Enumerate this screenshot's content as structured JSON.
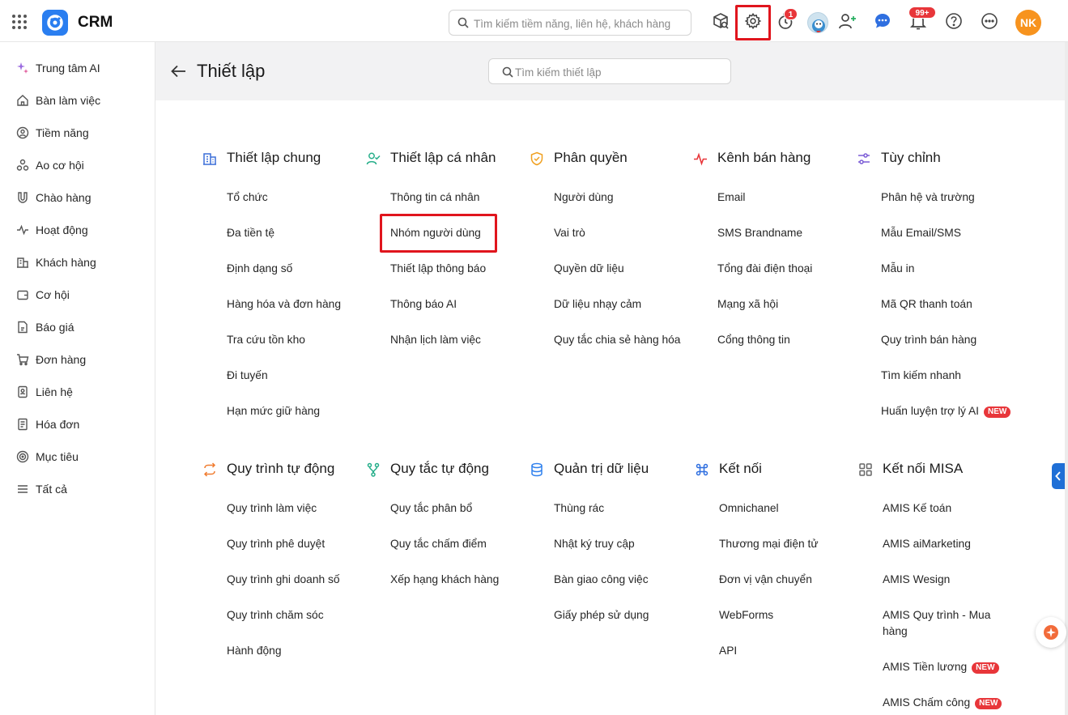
{
  "topbar": {
    "app_title": "CRM",
    "search_placeholder": "Tìm kiếm tiềm năng, liên hệ, khách hàng",
    "timer_badge": "1",
    "notification_badge": "99+",
    "avatar_initials": "NK",
    "icons": [
      "apps-grid-icon",
      "crm-logo-icon",
      "search-icon",
      "package-search-icon",
      "settings-gear-icon",
      "timer-icon",
      "bot-avatar-icon",
      "add-user-icon",
      "chat-icon",
      "bell-icon",
      "help-icon",
      "more-icon"
    ]
  },
  "sidebar": {
    "items": [
      {
        "label": "Trung tâm AI",
        "icon": "sparkle-icon"
      },
      {
        "label": "Bàn làm việc",
        "icon": "home-icon"
      },
      {
        "label": "Tiềm năng",
        "icon": "target-icon"
      },
      {
        "label": "Ao cơ hội",
        "icon": "nodes-icon"
      },
      {
        "label": "Chào hàng",
        "icon": "magnet-icon"
      },
      {
        "label": "Hoạt động",
        "icon": "activity-icon"
      },
      {
        "label": "Khách hàng",
        "icon": "building-icon"
      },
      {
        "label": "Cơ hội",
        "icon": "wallet-icon"
      },
      {
        "label": "Báo giá",
        "icon": "quote-file-icon"
      },
      {
        "label": "Đơn hàng",
        "icon": "cart-icon"
      },
      {
        "label": "Liên hệ",
        "icon": "contact-card-icon"
      },
      {
        "label": "Hóa đơn",
        "icon": "invoice-icon"
      },
      {
        "label": "Mục tiêu",
        "icon": "goal-icon"
      },
      {
        "label": "Tất cả",
        "icon": "menu-icon"
      }
    ]
  },
  "header": {
    "title": "Thiết lập",
    "search_placeholder": "Tìm kiếm thiết lập"
  },
  "groups": [
    {
      "title": "Thiết lập chung",
      "icon": "building-icon",
      "color": "#3b6fd8",
      "items": [
        {
          "label": "Tổ chức"
        },
        {
          "label": "Đa tiền tệ"
        },
        {
          "label": "Định dạng số"
        },
        {
          "label": "Hàng hóa và đơn hàng"
        },
        {
          "label": "Tra cứu tồn kho"
        },
        {
          "label": "Đi tuyến"
        },
        {
          "label": "Hạn mức giữ hàng"
        }
      ]
    },
    {
      "title": "Thiết lập cá nhân",
      "icon": "user-check-icon",
      "color": "#27ae8a",
      "items": [
        {
          "label": "Thông tin cá nhân"
        },
        {
          "label": "Nhóm người dùng"
        },
        {
          "label": "Thiết lập thông báo"
        },
        {
          "label": "Thông báo AI"
        },
        {
          "label": "Nhận lịch làm việc"
        }
      ]
    },
    {
      "title": "Phân quyền",
      "icon": "shield-check-icon",
      "color": "#f0a020",
      "items": [
        {
          "label": "Người dùng"
        },
        {
          "label": "Vai trò"
        },
        {
          "label": "Quyền dữ liệu"
        },
        {
          "label": "Dữ liệu nhạy cảm"
        },
        {
          "label": "Quy tắc chia sẻ hàng hóa"
        }
      ]
    },
    {
      "title": "Kênh bán hàng",
      "icon": "pulse-icon",
      "color": "#e8363a",
      "items": [
        {
          "label": "Email"
        },
        {
          "label": "SMS Brandname"
        },
        {
          "label": "Tổng đài điện thoại"
        },
        {
          "label": "Mạng xã hội"
        },
        {
          "label": "Cổng thông tin"
        }
      ]
    },
    {
      "title": "Tùy chỉnh",
      "icon": "sliders-icon",
      "color": "#7b5cd6",
      "items": [
        {
          "label": "Phân hệ và trường"
        },
        {
          "label": "Mẫu Email/SMS"
        },
        {
          "label": "Mẫu in"
        },
        {
          "label": "Mã QR thanh toán"
        },
        {
          "label": "Quy trình bán hàng"
        },
        {
          "label": "Tìm kiếm nhanh"
        },
        {
          "label": "Huấn luyện trợ lý AI",
          "badge": "NEW"
        }
      ]
    },
    {
      "title": "Quy trình tự động",
      "icon": "cycle-arrows-icon",
      "color": "#f07c30",
      "items": [
        {
          "label": "Quy trình làm việc"
        },
        {
          "label": "Quy trình phê duyệt"
        },
        {
          "label": "Quy trình ghi doanh số"
        },
        {
          "label": "Quy trình chăm sóc"
        },
        {
          "label": "Hành động"
        }
      ]
    },
    {
      "title": "Quy tắc tự động",
      "icon": "branch-icon",
      "color": "#27ae8a",
      "items": [
        {
          "label": "Quy tắc phân bổ"
        },
        {
          "label": "Quy tắc chấm điểm"
        },
        {
          "label": "Xếp hạng khách hàng"
        }
      ]
    },
    {
      "title": "Quản trị dữ liệu",
      "icon": "database-icon",
      "color": "#2f80ed",
      "items": [
        {
          "label": "Thùng rác"
        },
        {
          "label": "Nhật ký truy cập"
        },
        {
          "label": "Bàn giao công việc"
        },
        {
          "label": "Giấy phép sử dụng"
        }
      ]
    },
    {
      "title": "Kết nối",
      "icon": "command-icon",
      "color": "#2f6fe0",
      "items": [
        {
          "label": "Omnichanel"
        },
        {
          "label": "Thương mại điện tử"
        },
        {
          "label": "Đơn vị vận chuyển"
        },
        {
          "label": "WebForms"
        },
        {
          "label": "API"
        }
      ]
    },
    {
      "title": "Kết nối MISA",
      "icon": "grid-apps-icon",
      "color": "#666666",
      "items": [
        {
          "label": "AMIS Kế toán"
        },
        {
          "label": "AMIS aiMarketing"
        },
        {
          "label": "AMIS Wesign"
        },
        {
          "label": "AMIS Quy trình - Mua hàng"
        },
        {
          "label": "AMIS Tiền lương",
          "badge": "NEW"
        },
        {
          "label": "AMIS Chấm công",
          "badge": "NEW"
        }
      ]
    }
  ]
}
